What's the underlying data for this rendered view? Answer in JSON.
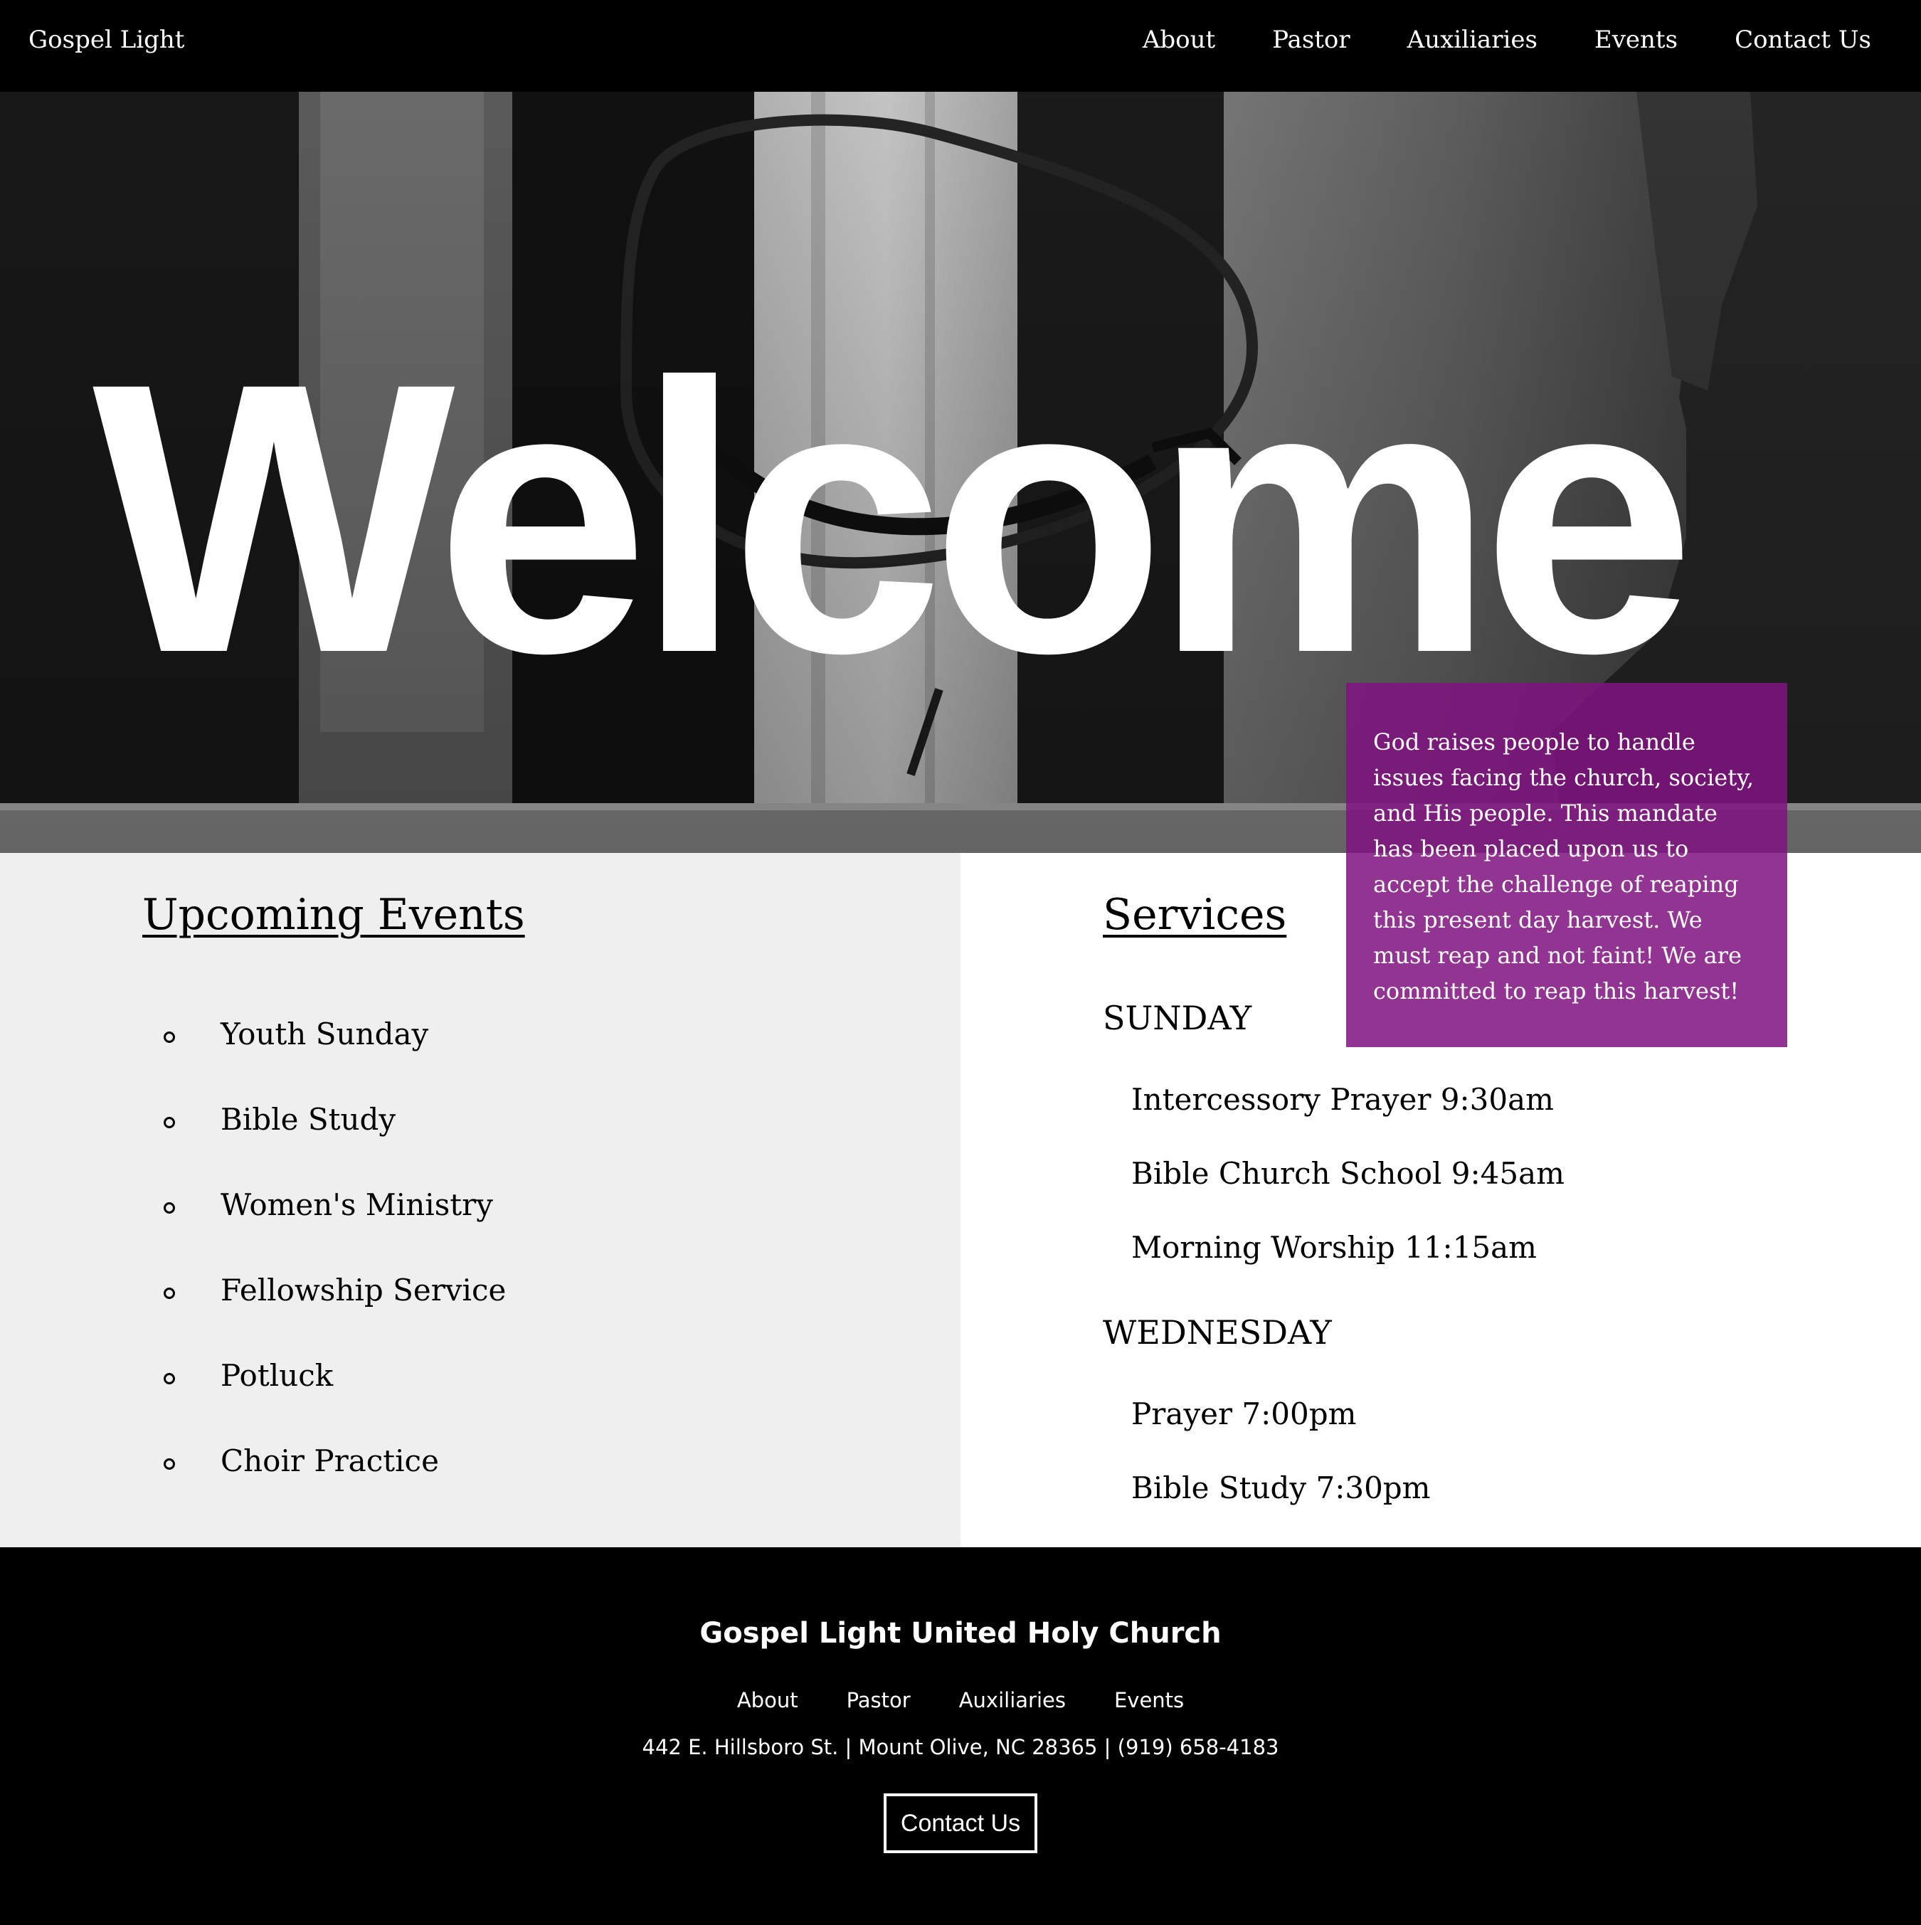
{
  "nav": {
    "brand": "Gospel Light",
    "links": [
      "About",
      "Pastor",
      "Auxiliaries",
      "Events",
      "Contact Us"
    ]
  },
  "hero": {
    "heading": "Welcome",
    "mission": "God raises people to handle issues facing the church, society, and His people. This mandate has been placed upon us to accept the challenge of reaping this present day harvest. We must reap and not faint! We are committed to reap this harvest!"
  },
  "events": {
    "title": "Upcoming Events",
    "items": [
      "Youth Sunday",
      "Bible Study",
      "Women's Ministry",
      "Fellowship Service",
      "Potluck",
      "Choir Practice"
    ]
  },
  "services": {
    "title": "Services",
    "days": [
      {
        "name": "SUNDAY",
        "items": [
          "Intercessory Prayer 9:30am",
          "Bible Church School 9:45am",
          "Morning Worship 11:15am"
        ]
      },
      {
        "name": "WEDNESDAY",
        "items": [
          "Prayer 7:00pm",
          "Bible Study 7:30pm"
        ]
      }
    ]
  },
  "footer": {
    "title": "Gospel Light United Holy Church",
    "links": [
      "About",
      "Pastor",
      "Auxiliaries",
      "Events"
    ],
    "address": "442 E. Hillsboro St. | Mount Olive, NC 28365 | (919) 658-4183",
    "button": "Contact Us"
  },
  "colors": {
    "accent": "#801480",
    "nav_bg": "#000000",
    "events_bg": "#efefef"
  }
}
